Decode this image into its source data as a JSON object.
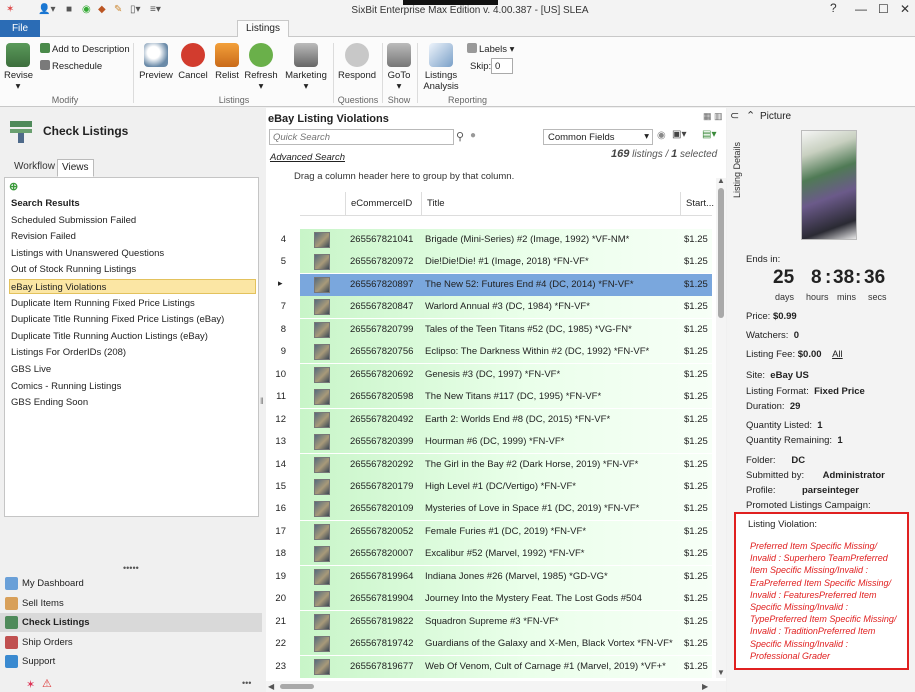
{
  "window": {
    "title": "SixBit Enterprise Max Edition v. 4.00.387 - [US] SLEA"
  },
  "tabs": {
    "file": "File",
    "listings": "Listings"
  },
  "ribbon": {
    "revise": "Revise",
    "add_to_description": "Add to Description",
    "reschedule": "Reschedule",
    "modify_group": "Modify",
    "preview": "Preview",
    "cancel": "Cancel",
    "relist": "Relist",
    "refresh": "Refresh",
    "marketing": "Marketing",
    "listings_group": "Listings",
    "respond": "Respond",
    "questions_group": "Questions",
    "goto": "GoTo",
    "show_group": "Show",
    "listings_analysis_1": "Listings",
    "listings_analysis_2": "Analysis",
    "labels": "Labels",
    "skip_label": "Skip:",
    "skip_value": "0",
    "reporting_group": "Reporting"
  },
  "left": {
    "title": "Check Listings",
    "tab_workflow": "Workflow",
    "tab_views": "Views",
    "views": [
      {
        "label": "Search Results",
        "bold": true
      },
      {
        "label": "Scheduled Submission Failed"
      },
      {
        "label": "Revision Failed"
      },
      {
        "label": "Listings with Unanswered Questions"
      },
      {
        "label": "Out of Stock Running Listings"
      },
      {
        "label": "eBay Listing Violations",
        "selected": true
      },
      {
        "label": "Duplicate Item Running Fixed Price Listings"
      },
      {
        "label": "Duplicate Title Running Fixed Price Listings (eBay)"
      },
      {
        "label": "Duplicate Title Running Auction Listings (eBay)"
      },
      {
        "label": "Listings For OrderIDs (208)"
      },
      {
        "label": "GBS Live"
      },
      {
        "label": "Comics - Running Listings"
      },
      {
        "label": "GBS Ending Soon"
      }
    ],
    "nav": [
      {
        "label": "My Dashboard",
        "color": "#6aa0d8"
      },
      {
        "label": "Sell Items",
        "color": "#d8a05a"
      },
      {
        "label": "Check Listings",
        "color": "#4f8a5a",
        "selected": true
      },
      {
        "label": "Ship Orders",
        "color": "#c05050"
      },
      {
        "label": "Support",
        "color": "#3a8ad0"
      }
    ]
  },
  "grid": {
    "title": "eBay Listing Violations",
    "search_placeholder": "Quick Search",
    "advanced_search": "Advanced Search",
    "field_selector": "Common Fields",
    "listings_count": "169",
    "listings_word": "listings",
    "selected_count": "1",
    "selected_word": "selected",
    "group_hint": "Drag a column header here to group by that column.",
    "columns": {
      "id": "eCommerceID",
      "title": "Title",
      "start": "Start..."
    },
    "rows": [
      {
        "num": "4",
        "id": "265567821041",
        "title": "Brigade (Mini-Series) #2 (Image, 1992) *VF-NM*",
        "price": "$1.25"
      },
      {
        "num": "5",
        "id": "265567820972",
        "title": "Die!Die!Die! #1 (Image, 2018) *FN-VF*",
        "price": "$1.25"
      },
      {
        "num": "",
        "id": "265567820897",
        "title": "The New 52: Futures End #4 (DC, 2014) *FN-VF*",
        "price": "$1.25",
        "selected": true
      },
      {
        "num": "7",
        "id": "265567820847",
        "title": "Warlord Annual #3 (DC, 1984) *FN-VF*",
        "price": "$1.25"
      },
      {
        "num": "8",
        "id": "265567820799",
        "title": "Tales of the Teen Titans #52 (DC, 1985) *VG-FN*",
        "price": "$1.25"
      },
      {
        "num": "9",
        "id": "265567820756",
        "title": "Eclipso: The Darkness Within #2 (DC, 1992) *FN-VF*",
        "price": "$1.25"
      },
      {
        "num": "10",
        "id": "265567820692",
        "title": "Genesis #3 (DC, 1997) *FN-VF*",
        "price": "$1.25"
      },
      {
        "num": "11",
        "id": "265567820598",
        "title": "The New Titans #117 (DC, 1995) *FN-VF*",
        "price": "$1.25"
      },
      {
        "num": "12",
        "id": "265567820492",
        "title": "Earth 2: Worlds End #8 (DC, 2015) *FN-VF*",
        "price": "$1.25"
      },
      {
        "num": "13",
        "id": "265567820399",
        "title": "Hourman #6 (DC, 1999) *FN-VF*",
        "price": "$1.25"
      },
      {
        "num": "14",
        "id": "265567820292",
        "title": "The Girl in the Bay #2 (Dark Horse, 2019) *FN-VF*",
        "price": "$1.25"
      },
      {
        "num": "15",
        "id": "265567820179",
        "title": "High Level #1 (DC/Vertigo) *FN-VF*",
        "price": "$1.25"
      },
      {
        "num": "16",
        "id": "265567820109",
        "title": "Mysteries of Love in Space #1 (DC, 2019) *FN-VF*",
        "price": "$1.25"
      },
      {
        "num": "17",
        "id": "265567820052",
        "title": "Female Furies #1 (DC, 2019) *FN-VF*",
        "price": "$1.25"
      },
      {
        "num": "18",
        "id": "265567820007",
        "title": "Excalibur #52 (Marvel, 1992) *FN-VF*",
        "price": "$1.25"
      },
      {
        "num": "19",
        "id": "265567819964",
        "title": "Indiana Jones #26 (Marvel, 1985) *GD-VG*",
        "price": "$1.25"
      },
      {
        "num": "20",
        "id": "265567819904",
        "title": "Journey Into the Mystery Feat. The Lost Gods #504",
        "price": "$1.25"
      },
      {
        "num": "21",
        "id": "265567819822",
        "title": "Squadron Supreme #3 *FN-VF*",
        "price": "$1.25"
      },
      {
        "num": "22",
        "id": "265567819742",
        "title": "Guardians of the Galaxy and X-Men, Black Vortex *FN-VF*",
        "price": "$1.25"
      },
      {
        "num": "23",
        "id": "265567819677",
        "title": "Web Of Venom, Cult of Carnage #1 (Marvel, 2019) *VF+*",
        "price": "$1.25"
      }
    ]
  },
  "details": {
    "tab_label": "Listing Details",
    "picture_label": "Picture",
    "ends_in": "Ends in:",
    "days": "25",
    "hours": "8",
    "mins": "38",
    "secs": "36",
    "days_label": "days",
    "hours_label": "hours",
    "mins_label": "mins",
    "secs_label": "secs",
    "price_label": "Price:",
    "price": "$0.99",
    "watchers_label": "Watchers:",
    "watchers": "0",
    "fee_label": "Listing Fee:",
    "fee": "$0.00",
    "fee_all": "All",
    "site_label": "Site:",
    "site": "eBay US",
    "format_label": "Listing Format:",
    "format": "Fixed Price",
    "duration_label": "Duration:",
    "duration": "29",
    "qty_listed_label": "Quantity Listed:",
    "qty_listed": "1",
    "qty_remaining_label": "Quantity Remaining:",
    "qty_remaining": "1",
    "folder_label": "Folder:",
    "folder": "DC",
    "submitted_label": "Submitted by:",
    "submitted": "Administrator",
    "profile_label": "Profile:",
    "profile": "parseinteger",
    "promoted_label": "Promoted Listings Campaign:",
    "violation_label": "Listing Violation:",
    "violation_text": "Preferred Item Specific Missing/ Invalid : Superhero TeamPreferred Item Specific Missing/Invalid : EraPreferred Item Specific Missing/ Invalid : FeaturesPreferred Item Specific Missing/Invalid : TypePreferred Item Specific Missing/ Invalid : TraditionPreferred Item Specific Missing/Invalid : Professional Grader"
  }
}
